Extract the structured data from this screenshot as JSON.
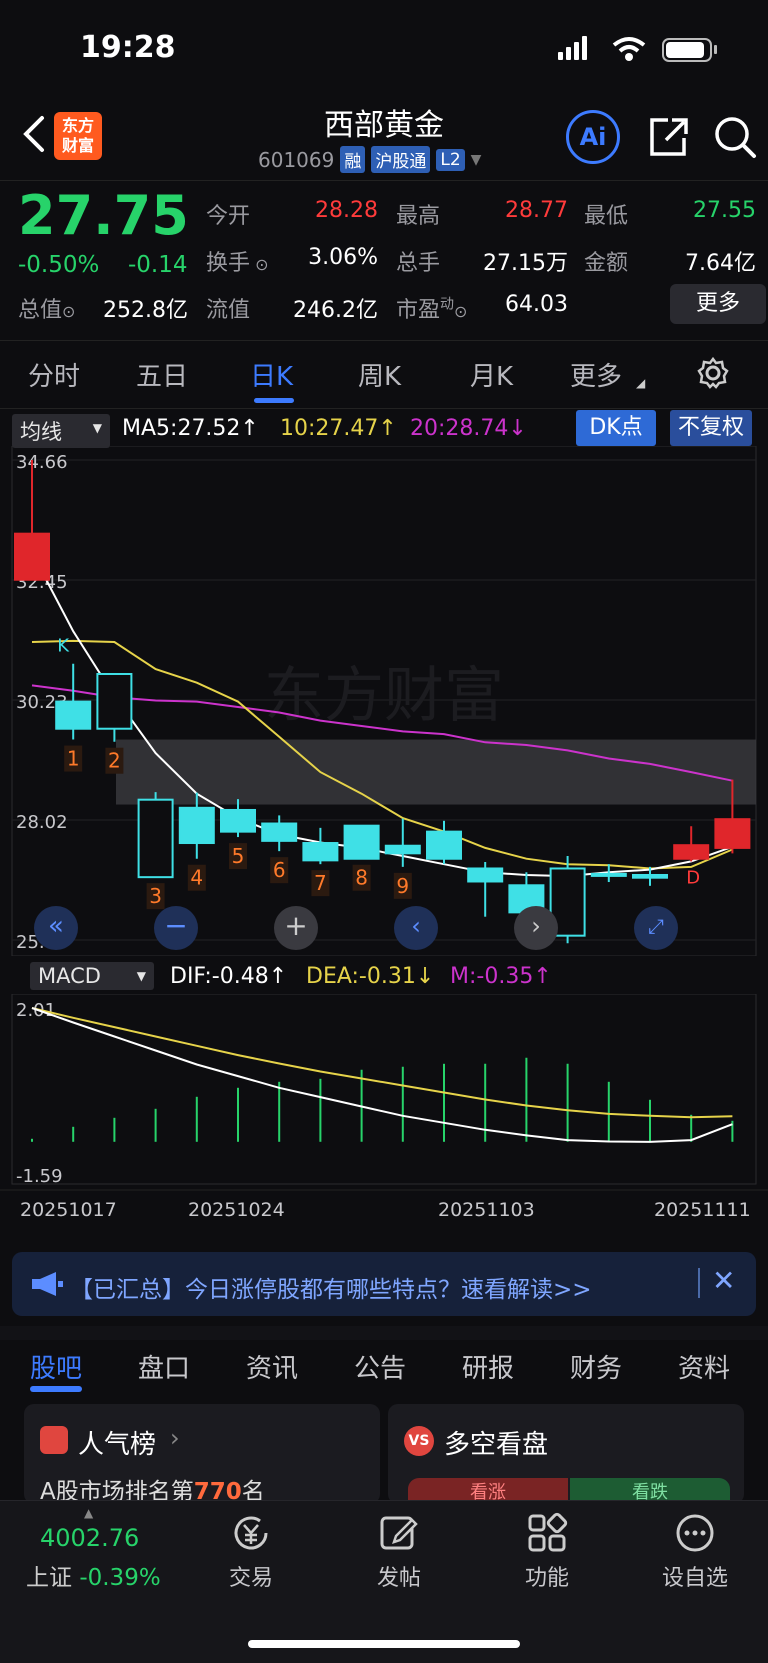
{
  "status": {
    "time": "19:28"
  },
  "header": {
    "logo_line1": "东方",
    "logo_line2": "财富",
    "name": "西部黄金",
    "code": "601069",
    "tags": [
      "融",
      "沪股通",
      "L2"
    ],
    "ai_label": "Ai"
  },
  "quote": {
    "price": "27.75",
    "change_pct": "-0.50%",
    "change": "-0.14",
    "open_label": "今开",
    "open": "28.28",
    "high_label": "最高",
    "high": "28.77",
    "low_label": "最低",
    "low": "27.55",
    "turnover_label": "换手",
    "turnover": "3.06%",
    "volume_label": "总手",
    "volume": "27.15万",
    "amount_label": "金额",
    "amount": "7.64亿",
    "mktcap_label": "总值",
    "mktcap": "252.8亿",
    "float_label": "流值",
    "float": "246.2亿",
    "pe_label": "市盈",
    "pe_sup": "动",
    "pe": "64.03",
    "more": "更多"
  },
  "period_tabs": [
    "分时",
    "五日",
    "日K",
    "周K",
    "月K",
    "更多"
  ],
  "kline": {
    "ma_dropdown": "均线",
    "ma5": "MA5:27.52",
    "ma10": "10:27.47",
    "ma20": "20:28.74",
    "dk_btn": "DK点",
    "fq_btn": "不复权",
    "y_labels": [
      "34.66",
      "32.45",
      "30.23",
      "28.02",
      "25.80"
    ],
    "k_marker": "K",
    "d_marker": "D",
    "watermark": "东方财富",
    "colors": {
      "up": "#e0262b",
      "down": "#3fe0e6",
      "ma5": "#ffffff",
      "ma10": "#e6d34a",
      "ma20": "#cc33cc"
    }
  },
  "chart_data": {
    "type": "candlestick",
    "ylim": [
      25.8,
      34.66
    ],
    "candles": [
      {
        "o": 32.45,
        "c": 33.3,
        "h": 34.66,
        "l": 32.45
      },
      {
        "o": 30.2,
        "c": 29.7,
        "h": 30.9,
        "l": 29.5,
        "label": "1"
      },
      {
        "o": 30.71,
        "c": 29.7,
        "h": 30.71,
        "l": 29.46,
        "label": "2"
      },
      {
        "o": 28.39,
        "c": 26.96,
        "h": 28.53,
        "l": 26.96,
        "label": "3"
      },
      {
        "o": 28.24,
        "c": 27.59,
        "h": 28.52,
        "l": 27.3,
        "label": "4"
      },
      {
        "o": 28.2,
        "c": 27.8,
        "h": 28.4,
        "l": 27.7,
        "label": "5"
      },
      {
        "o": 27.95,
        "c": 27.63,
        "h": 28.1,
        "l": 27.44,
        "label": "6"
      },
      {
        "o": 27.59,
        "c": 27.27,
        "h": 27.87,
        "l": 27.2,
        "label": "7"
      },
      {
        "o": 27.91,
        "c": 27.3,
        "h": 27.91,
        "l": 27.3,
        "label": "8"
      },
      {
        "o": 27.54,
        "c": 27.4,
        "h": 28.04,
        "l": 27.15,
        "label": "9"
      },
      {
        "o": 27.8,
        "c": 27.3,
        "h": 28.0,
        "l": 27.2
      },
      {
        "o": 27.12,
        "c": 26.88,
        "h": 27.24,
        "l": 26.23
      },
      {
        "o": 26.81,
        "c": 26.31,
        "h": 27.05,
        "l": 26.27
      },
      {
        "o": 27.12,
        "c": 25.88,
        "h": 27.35,
        "l": 25.74
      },
      {
        "o": 27.02,
        "c": 27.0,
        "h": 27.2,
        "l": 26.87
      },
      {
        "o": 27.0,
        "c": 26.95,
        "h": 27.15,
        "l": 26.8
      },
      {
        "o": 27.3,
        "c": 27.55,
        "h": 27.9,
        "l": 27.25
      },
      {
        "o": 27.5,
        "c": 28.03,
        "h": 28.76,
        "l": 27.4
      }
    ],
    "ma5": [
      32.95,
      31.5,
      30.3,
      29.25,
      28.5,
      28.05,
      27.75,
      27.6,
      27.5,
      27.35,
      27.2,
      27.05,
      27.0,
      26.98,
      27.05,
      27.1,
      27.25,
      27.52
    ],
    "ma10": [
      31.3,
      31.32,
      31.3,
      30.8,
      30.55,
      30.2,
      29.55,
      28.9,
      28.5,
      28.05,
      27.8,
      27.5,
      27.3,
      27.2,
      27.18,
      27.12,
      27.15,
      27.47
    ],
    "ma20": [
      30.5,
      30.4,
      30.28,
      30.22,
      30.2,
      30.1,
      30.0,
      29.85,
      29.75,
      29.65,
      29.6,
      29.45,
      29.4,
      29.3,
      29.15,
      29.05,
      28.9,
      28.74
    ],
    "macd": {
      "dif": [
        2.01,
        1.7,
        1.4,
        1.1,
        0.8,
        0.55,
        0.3,
        0.1,
        -0.1,
        -0.3,
        -0.45,
        -0.6,
        -0.72,
        -0.82,
        -0.85,
        -0.86,
        -0.82,
        -0.48
      ],
      "dea": [
        2.01,
        1.8,
        1.6,
        1.4,
        1.2,
        1.0,
        0.82,
        0.65,
        0.5,
        0.35,
        0.2,
        0.05,
        -0.08,
        -0.18,
        -0.26,
        -0.3,
        -0.33,
        -0.31
      ],
      "m": [
        -0.05,
        -0.25,
        -0.4,
        -0.55,
        -0.75,
        -0.9,
        -1.0,
        -1.05,
        -1.2,
        -1.25,
        -1.3,
        -1.3,
        -1.4,
        -1.3,
        -1.0,
        -0.7,
        -0.45,
        -0.35
      ]
    }
  },
  "macd": {
    "dropdown": "MACD",
    "dif": "DIF:-0.48",
    "dea": "DEA:-0.31",
    "m": "M:-0.35",
    "y_top": "2.01",
    "y_bottom": "-1.59",
    "dates": [
      "20251017",
      "20251024",
      "20251103",
      "20251111"
    ]
  },
  "news": {
    "text": "【已汇总】今日涨停股都有哪些特点？速看解读>>"
  },
  "bottom_tabs": [
    "股吧",
    "盘口",
    "资讯",
    "公告",
    "研报",
    "财务",
    "资料"
  ],
  "cards": {
    "popular_title": "人气榜",
    "popular_prefix": "A股市场排名第",
    "popular_rank": "770",
    "popular_suffix": "名",
    "vs_badge": "VS",
    "longshort_title": "多空看盘",
    "bull": "看涨",
    "bear": "看跌"
  },
  "bottom_nav": {
    "index_value": "4002.76",
    "index_name": "上证",
    "index_change": "-0.39%",
    "trade": "交易",
    "post": "发帖",
    "function": "功能",
    "watchlist": "设自选"
  }
}
